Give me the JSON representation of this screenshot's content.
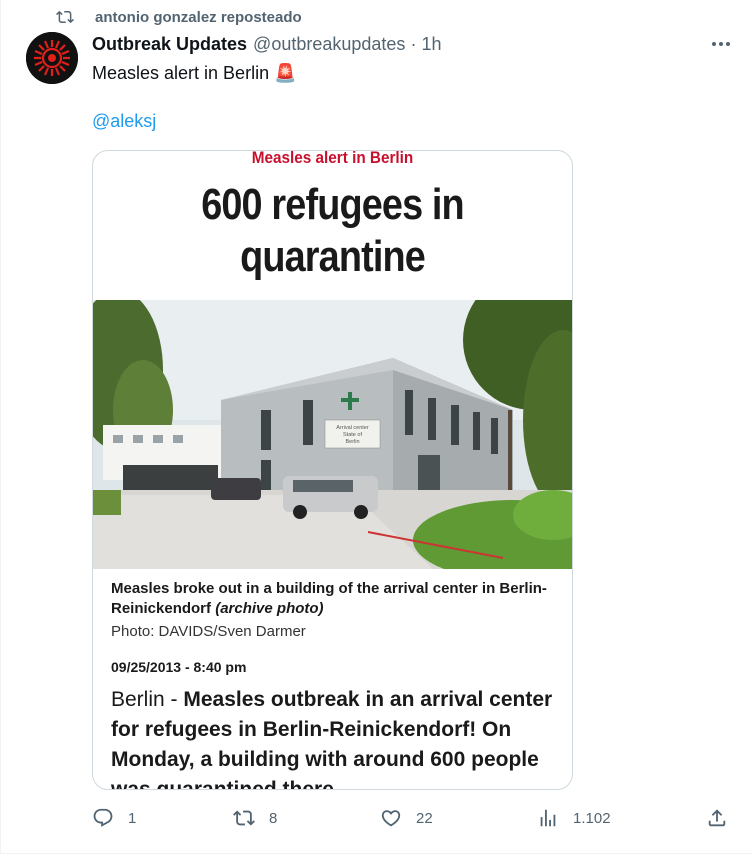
{
  "repost": {
    "label": "antonio gonzalez reposteado",
    "icon": "repost-icon"
  },
  "author": {
    "display_name": "Outbreak Updates",
    "handle": "@outbreakupdates",
    "separator": "·",
    "time": "1h",
    "avatar_icon": "outbreak-logo"
  },
  "tweet": {
    "text": "Measles alert in Berlin 🚨",
    "mention": "@aleksj"
  },
  "card": {
    "kicker": "Measles alert in Berlin",
    "headline_line1": "600 refugees in",
    "headline_line2": "quarantine",
    "photo_sign": {
      "line1": "Arrival center",
      "line2": "State of",
      "line3": "Berlin"
    },
    "caption_main": "Measles broke out in a building of the arrival center in Berlin-Reinickendorf",
    "caption_italic": "(archive photo)",
    "credit": "Photo: DAVIDS/Sven Darmer",
    "date": "09/25/2013 - 8:40 pm",
    "body_place": "Berlin - ",
    "body_bold": "Measles outbreak in an arrival center for refugees in Berlin-Reinickendorf! On Monday, a building with around 600 people was quarantined there."
  },
  "actions": {
    "reply_count": "1",
    "repost_count": "8",
    "like_count": "22",
    "views_count": "1.102"
  },
  "colors": {
    "accent": "#1d9bf0",
    "muted": "#536471",
    "kicker_red": "#c8102e"
  }
}
